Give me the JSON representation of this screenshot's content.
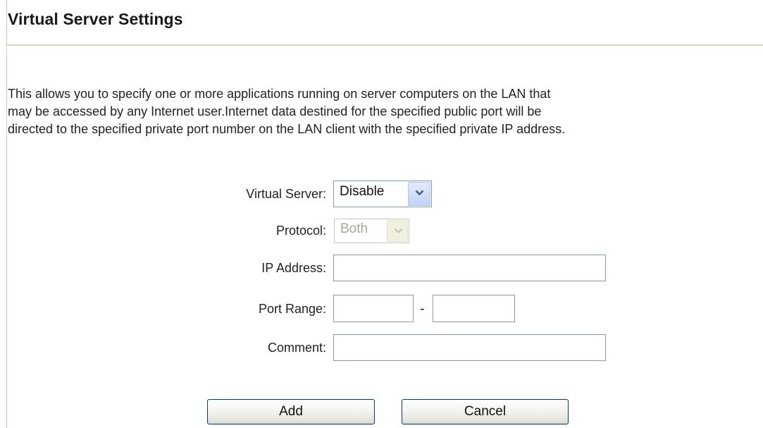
{
  "header": {
    "title": "Virtual Server Settings"
  },
  "description": {
    "lines": [
      "This allows you to specify one or more applications running on server computers on the LAN that",
      "may be accessed by any Internet user.Internet data destined for the specified public port will be",
      "directed to the specified private port number on the LAN client with the specified private IP address."
    ]
  },
  "form": {
    "virtual_server": {
      "label": "Virtual Server:",
      "selected": "Disable"
    },
    "protocol": {
      "label": "Protocol:",
      "selected": "Both",
      "disabled": true
    },
    "ip_address": {
      "label": "IP Address:",
      "value": ""
    },
    "port_range": {
      "label": "Port Range:",
      "start_value": "",
      "separator": "-",
      "end_value": ""
    },
    "comment": {
      "label": "Comment:",
      "value": ""
    }
  },
  "actions": {
    "add_label": "Add",
    "cancel_label": "Cancel"
  },
  "icons": {
    "dropdown": "chevron-down-icon"
  },
  "colors": {
    "input_border": "#7f9db9",
    "button_border": "#003c74",
    "rule": "#d8d3c2"
  }
}
